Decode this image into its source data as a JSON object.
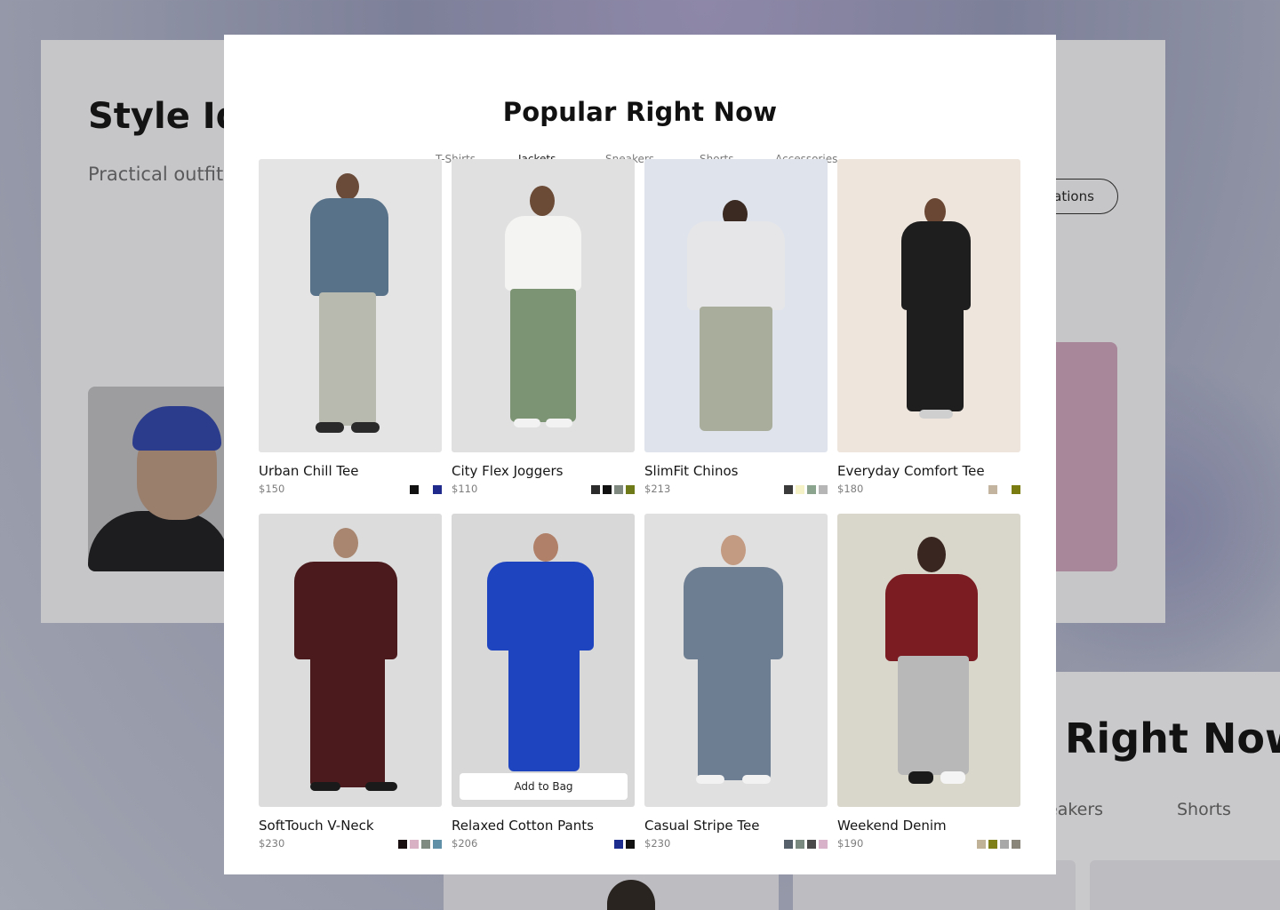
{
  "background": {
    "title": "Style Ide",
    "description": "Practical outfit effortless every",
    "pill_label": "rations",
    "title2": "Right Now",
    "tabs": [
      "eakers",
      "Shorts"
    ]
  },
  "modal": {
    "title": "Popular Right Now",
    "tabs": [
      {
        "label": "T-Shirts",
        "active": false
      },
      {
        "label": "Jackets",
        "active": true
      },
      {
        "label": "Sneakers",
        "active": false
      },
      {
        "label": "Shorts",
        "active": false
      },
      {
        "label": "Accessories",
        "active": false
      }
    ],
    "add_to_bag_label": "Add to Bag",
    "products": [
      {
        "name": "Urban Chill Tee",
        "price": "$150",
        "swatches": [
          "#111111",
          "#ffffff",
          "#1f2a8c"
        ]
      },
      {
        "name": "City Flex Joggers",
        "price": "$110",
        "swatches": [
          "#2b2b2b",
          "#111111",
          "#808a80",
          "#6e7a18"
        ]
      },
      {
        "name": "SlimFit Chinos",
        "price": "$213",
        "swatches": [
          "#3a3a3a",
          "#f5f2c8",
          "#8aa48e",
          "#b6b6b6"
        ]
      },
      {
        "name": "Everyday Comfort Tee",
        "price": "$180",
        "swatches": [
          "#c2b49e",
          "#ffffff",
          "#7a7c12"
        ]
      },
      {
        "name": "SoftTouch V-Neck",
        "price": "$230",
        "swatches": [
          "#1a0f10",
          "#d8b2c4",
          "#7f8a80",
          "#5f90a8"
        ]
      },
      {
        "name": "Relaxed Cotton Pants",
        "price": "$206",
        "swatches": [
          "#1c2b8e",
          "#111111"
        ]
      },
      {
        "name": "Casual Stripe Tee",
        "price": "$230",
        "swatches": [
          "#55606a",
          "#7a8a80",
          "#4a4a4a",
          "#d8b2c8"
        ]
      },
      {
        "name": "Weekend Denim",
        "price": "$190",
        "swatches": [
          "#bfb296",
          "#7f8018",
          "#a8a8a8",
          "#8a877a"
        ]
      }
    ]
  }
}
